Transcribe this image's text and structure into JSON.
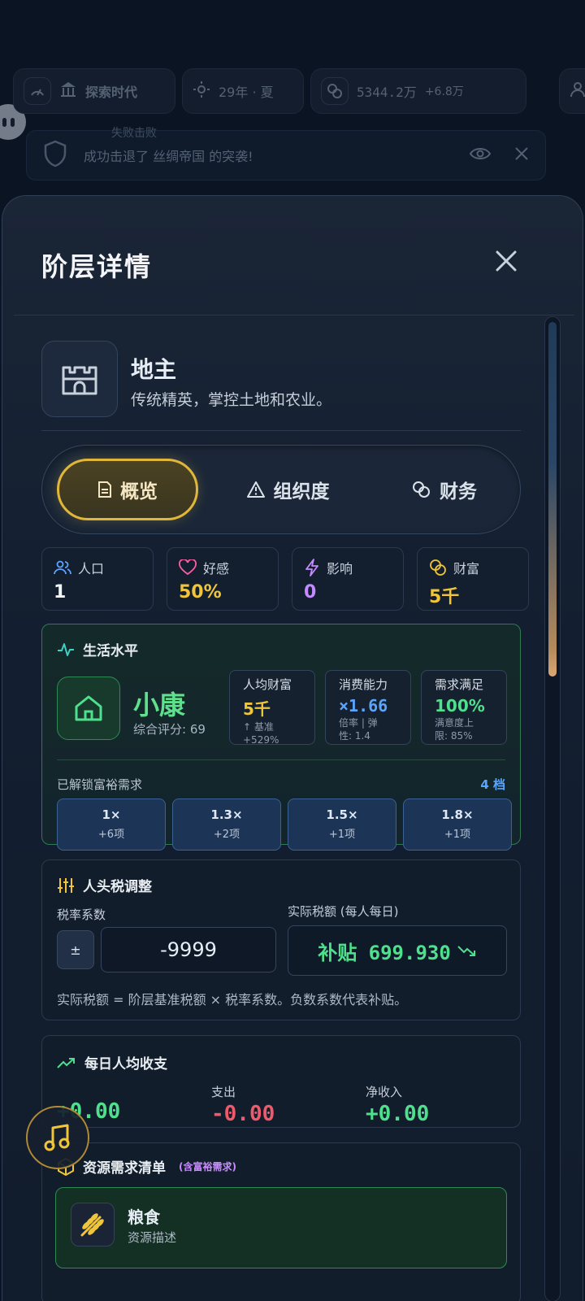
{
  "background": {
    "era_label": "探索时代",
    "date_label": "29年 · 夏",
    "money_value": "5344.2万",
    "money_delta": "+6.8万",
    "notice_title": "失败击败",
    "notice_text": "成功击退了 丝绸帝国 的突袭!"
  },
  "panel": {
    "title": "阶层详情",
    "class_name": "地主",
    "class_desc": "传统精英，掌控土地和农业。",
    "tabs": [
      {
        "label": "概览",
        "icon": "document-icon",
        "active": true
      },
      {
        "label": "组织度",
        "icon": "warning-icon",
        "active": false
      },
      {
        "label": "财务",
        "icon": "coins-icon",
        "active": false
      }
    ],
    "stats": [
      {
        "label": "人口",
        "value": "1",
        "color": "#f2f5f8",
        "icon": "users-icon"
      },
      {
        "label": "好感",
        "value": "50%",
        "color": "#f0c53a",
        "icon": "heart-icon"
      },
      {
        "label": "影响",
        "value": "0",
        "color": "#c38bff",
        "icon": "lightning-icon"
      },
      {
        "label": "财富",
        "value": "5千",
        "color": "#f0c53a",
        "icon": "coins-icon"
      }
    ]
  },
  "living": {
    "title": "生活水平",
    "level": "小康",
    "score": "综合评分: 69",
    "metrics": [
      {
        "label": "人均财富",
        "value": "5千",
        "color": "#f0c53a",
        "sub1": "↑ 基准",
        "sub2": "+529%"
      },
      {
        "label": "消费能力",
        "value": "×1.66",
        "color": "#5aa6ff",
        "sub1": "倍率 | 弹",
        "sub2": "性: 1.4"
      },
      {
        "label": "需求满足",
        "value": "100%",
        "color": "#4fe08d",
        "sub1": "满意度上",
        "sub2": "限: 85%"
      }
    ],
    "unlock_label": "已解锁富裕需求",
    "unlock_count": "4 档",
    "tiers": [
      {
        "mult": "1×",
        "count": "+6项"
      },
      {
        "mult": "1.3×",
        "count": "+2项"
      },
      {
        "mult": "1.5×",
        "count": "+1项"
      },
      {
        "mult": "1.8×",
        "count": "+1项"
      }
    ]
  },
  "tax": {
    "title": "人头税调整",
    "rate_label": "税率系数",
    "pm_label": "±",
    "rate_value": "-9999",
    "actual_label": "实际税额 (每人每日)",
    "actual_value": "补贴 699.930",
    "note": "实际税额 = 阶层基准税额 × 税率系数。负数系数代表补贴。"
  },
  "daily": {
    "title": "每日人均收支",
    "income_value": "+0.00",
    "expense_label": "支出",
    "expense_value": "-0.00",
    "net_label": "净收入",
    "net_value": "+0.00"
  },
  "resources": {
    "title": "资源需求清单",
    "tag": "(含富裕需求)",
    "items": [
      {
        "name": "粮食",
        "desc": "资源描述",
        "icon": "wheat-icon"
      }
    ]
  },
  "colors": {
    "accent_gold": "#e0b73a",
    "green": "#4fe08d",
    "red": "#ef5a6a",
    "blue": "#5aa6ff"
  }
}
